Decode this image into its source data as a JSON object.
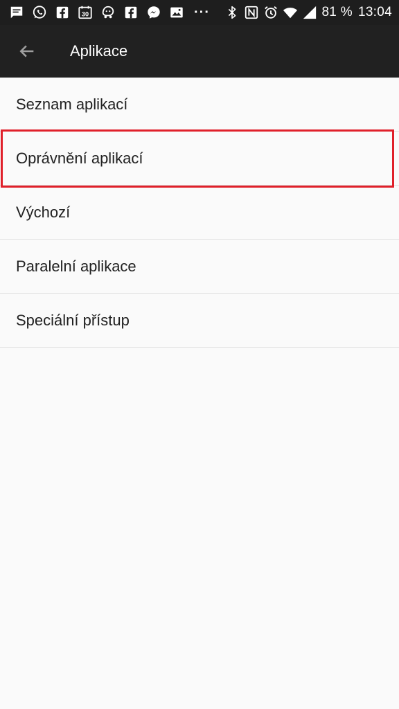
{
  "status_bar": {
    "left_icons": [
      "message-icon",
      "whatsapp-icon",
      "facebook-icon",
      "calendar-icon",
      "waze-icon",
      "facebook-icon",
      "messenger-icon",
      "image-icon"
    ],
    "calendar_day": "30",
    "overflow": "···",
    "right_icons": [
      "bluetooth-icon",
      "nfc-icon",
      "alarm-icon",
      "wifi-icon",
      "signal-icon"
    ],
    "battery": "81 %",
    "time": "13:04"
  },
  "toolbar": {
    "title": "Aplikace"
  },
  "list": {
    "items": [
      {
        "label": "Seznam aplikací"
      },
      {
        "label": "Oprávnění aplikací",
        "highlighted": true
      },
      {
        "label": "Výchozí"
      },
      {
        "label": "Paralelní aplikace"
      },
      {
        "label": "Speciální přístup"
      }
    ]
  },
  "colors": {
    "status_bar_bg": "#1e1e1e",
    "toolbar_bg": "#212121",
    "list_bg": "#fafafa",
    "divider": "#e0e0e0",
    "highlight": "#e0202a"
  }
}
